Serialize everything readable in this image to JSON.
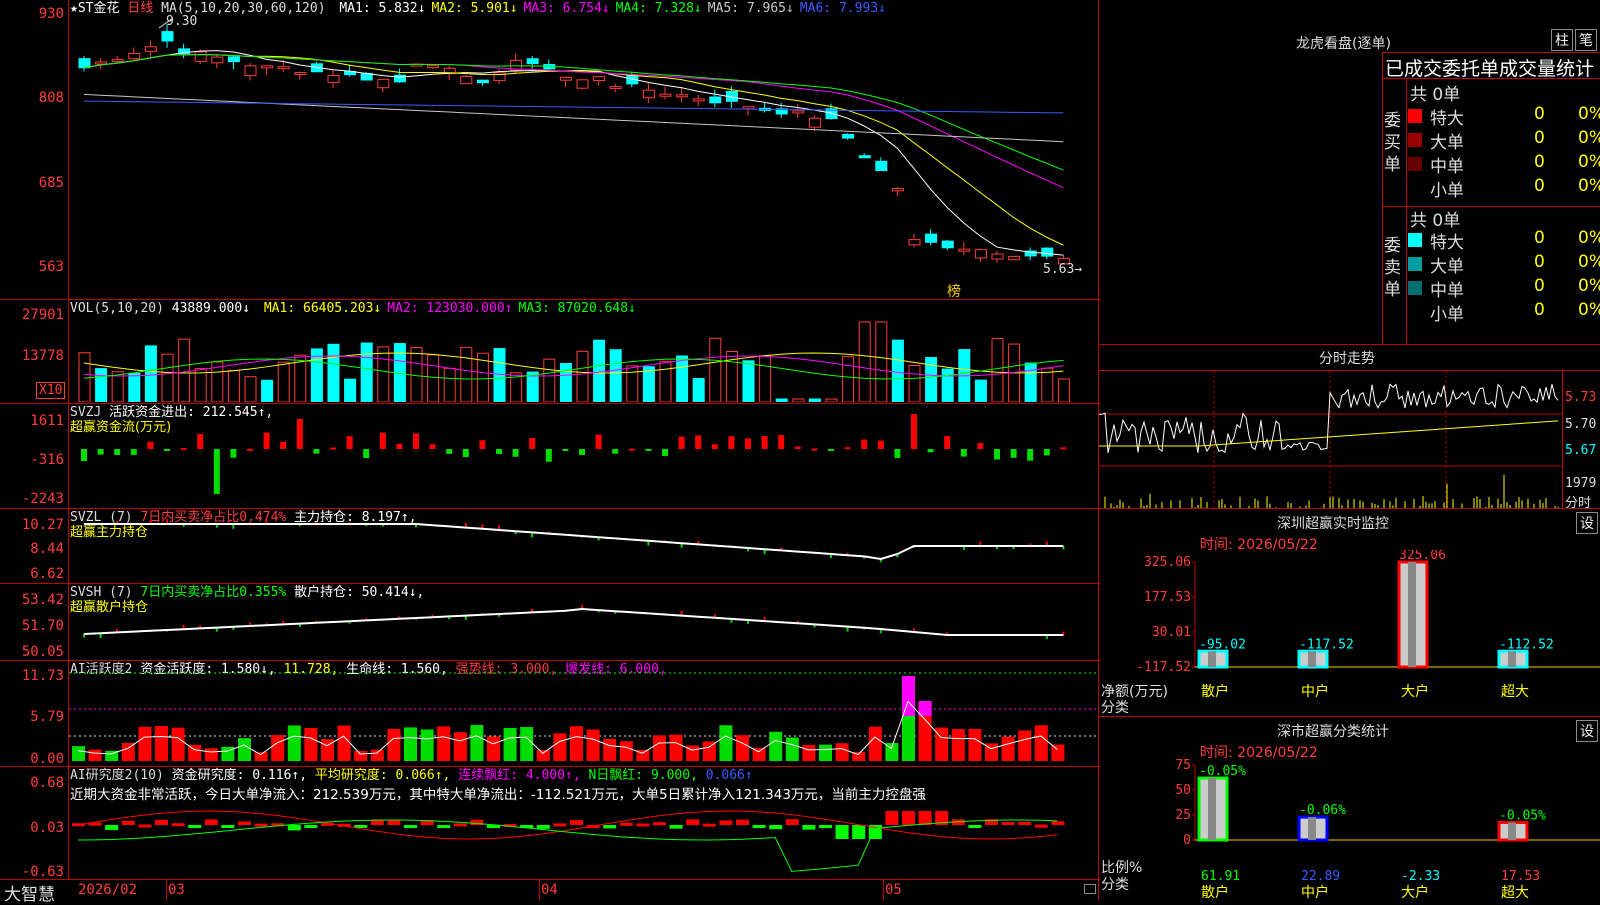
{
  "stock": {
    "name": "★ST金花",
    "period": "日线",
    "ma_header": "MA(5,10,20,30,60,120)",
    "ma": [
      {
        "label": "MA1: 5.832↓",
        "color": "#ffffff"
      },
      {
        "label": "MA2: 5.901↓",
        "color": "#ffff00"
      },
      {
        "label": "MA3: 6.754↓",
        "color": "#ff00ff"
      },
      {
        "label": "MA4: 7.328↓",
        "color": "#00ff00"
      },
      {
        "label": "MA5: 7.965↓",
        "color": "#c8c8c8"
      },
      {
        "label": "MA6: 7.993↓",
        "color": "#3a5bff"
      }
    ],
    "peak_label": "9.30",
    "last_label": "5.63→",
    "bang_label": "榜"
  },
  "price_axis": [
    "930",
    "808",
    "685",
    "563"
  ],
  "vol": {
    "header": "VOL(5,10,20)",
    "value": "43889.000↓",
    "ma": [
      {
        "label": "MA1: 66405.203↓",
        "color": "#ffff00"
      },
      {
        "label": "MA2: 123030.000↑",
        "color": "#ff00ff"
      },
      {
        "label": "MA3: 87020.648↓",
        "color": "#00ff00"
      }
    ],
    "axis": [
      "27901",
      "13778"
    ],
    "unit": "X10"
  },
  "svzj": {
    "header": "SVZJ",
    "label": "活跃资金进出: 212.545↑,",
    "sub": "超赢资金流(万元)",
    "axis": [
      "1611",
      "-316",
      "-2243"
    ]
  },
  "svzl": {
    "header": "SVZL (7)",
    "pct": "7日内买卖净占比0.474%",
    "label": "主力持仓: 8.197↑,",
    "sub": "超赢主力持仓",
    "axis": [
      "10.27",
      "8.44",
      "6.62"
    ]
  },
  "svsh": {
    "header": "SVSH (7)",
    "pct": "7日内买卖净占比0.355%",
    "label": "散户持仓: 50.414↓,",
    "sub": "超赢散户持仓",
    "axis": [
      "53.42",
      "51.70",
      "50.05"
    ]
  },
  "ai1": {
    "header": "AI活跃度2",
    "a": "资金活跃度: 1.580↓,",
    "b": "11.728,",
    "c": "生命线: 1.560,",
    "d": "强势线: 3.000,",
    "e": "爆发线: 6.000,",
    "axis": [
      "11.73",
      "5.79",
      "0.00"
    ]
  },
  "ai2": {
    "header": "AI研究度2(10)",
    "a": "资金研究度: 0.116↑,",
    "b": "平均研究度: 0.066↑,",
    "c": "连续飘红: 4.000↑,",
    "d": "N日飘红: 9.000,",
    "e": "0.066↑",
    "comment": "近期大资金非常活跃，今日大单净流入：212.539万元，其中特大单净流出：-112.521万元，大单5日累计净入121.343万元，当前主力控盘强",
    "axis": [
      "0.68",
      "0.03",
      "-0.63"
    ]
  },
  "bottom": {
    "brand": "大智慧",
    "dates": [
      "2026/02",
      "03",
      "04",
      "05"
    ]
  },
  "longhu": {
    "title": "龙虎看盘(逐单)",
    "btn1": "柱",
    "btn2": "笔",
    "subtitle": "已成交委托单成交量统计",
    "buy_label": "委买单",
    "sell_label": "委卖单",
    "buy_total": "共 0单",
    "sell_total": "共 0单",
    "buy_rows": [
      {
        "name": "特大",
        "v": "0",
        "p": "0%",
        "color": "#ff0000"
      },
      {
        "name": "大单",
        "v": "0",
        "p": "0%",
        "color": "#990000"
      },
      {
        "name": "中单",
        "v": "0",
        "p": "0%",
        "color": "#660000"
      },
      {
        "name": "小单",
        "v": "0",
        "p": "0%",
        "color": ""
      }
    ],
    "sell_rows": [
      {
        "name": "特大",
        "v": "0",
        "p": "0%",
        "color": "#00ffff"
      },
      {
        "name": "大单",
        "v": "0",
        "p": "0%",
        "color": "#00a0a0"
      },
      {
        "name": "中单",
        "v": "0",
        "p": "0%",
        "color": "#007070"
      },
      {
        "name": "小单",
        "v": "0",
        "p": "0%",
        "color": ""
      }
    ]
  },
  "fenshi": {
    "title": "分时走势",
    "axis": [
      "5.73",
      "5.70",
      "5.67"
    ],
    "vol_axis": [
      "1979",
      "分时"
    ]
  },
  "sz_monitor": {
    "title": "深圳超赢实时监控",
    "btn": "设",
    "date": "时间: 2026/05/22",
    "unit": "净额(万元)",
    "cat": "分类",
    "axis": [
      "325.06",
      "177.53",
      "30.01",
      "-117.52"
    ],
    "labels": [
      "散户",
      "中户",
      "大户",
      "超大"
    ],
    "values": [
      -95.02,
      -117.52,
      325.06,
      -112.52
    ],
    "value_labels": [
      "-95.02",
      "-117.52",
      "325.06",
      "-112.52"
    ]
  },
  "sz_class": {
    "title": "深市超赢分类统计",
    "btn": "设",
    "date": "时间: 2026/05/22",
    "unit": "比例%",
    "cat": "分类",
    "axis": [
      "75",
      "50",
      "25",
      "0"
    ],
    "labels": [
      "散户",
      "中户",
      "大户",
      "超大"
    ],
    "pct_labels": [
      "-0.05%",
      "-0.06%",
      "",
      "-0.05%"
    ],
    "values": [
      61.91,
      22.89,
      -2.33,
      17.53
    ],
    "value_labels": [
      "61.91",
      "22.89",
      "-2.33",
      "17.53"
    ]
  },
  "chart_data": [
    {
      "type": "bar",
      "title": "深圳超赢实时监控",
      "ylabel": "净额(万元)",
      "categories": [
        "散户",
        "中户",
        "大户",
        "超大"
      ],
      "values": [
        -95.02,
        -117.52,
        325.06,
        -112.52
      ],
      "ylim": [
        -117.52,
        325.06
      ]
    },
    {
      "type": "bar",
      "title": "深市超赢分类统计",
      "ylabel": "比例%",
      "categories": [
        "散户",
        "中户",
        "大户",
        "超大"
      ],
      "values": [
        61.91,
        22.89,
        -2.33,
        17.53
      ],
      "ylim": [
        0,
        75
      ]
    }
  ]
}
